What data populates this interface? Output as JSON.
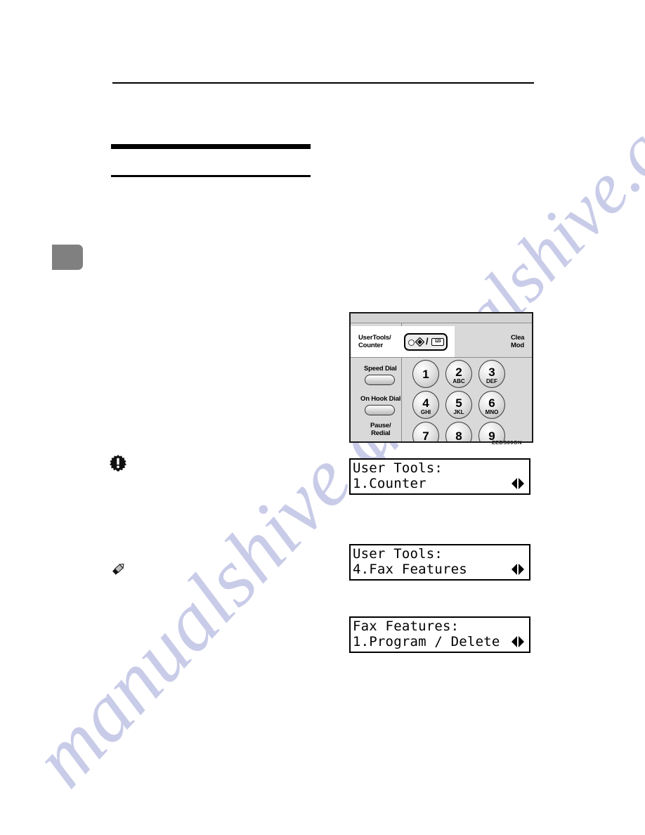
{
  "page": {
    "watermark_text": "manualshive.com",
    "chapter_tab": "",
    "figure_caption": "ZEDS06GN"
  },
  "notices": {
    "important_icon": "important-starburst-icon",
    "note_icon": "note-pencil-icon"
  },
  "control_panel": {
    "user_tools_counter_label": "UserTools/\nCounter",
    "user_tools_label_line1": "UserTools/",
    "user_tools_label_line2": "Counter",
    "clear_modes_label_line1": "Clea",
    "clear_modes_label_line2": "Mod",
    "speed_dial_label": "Speed Dial",
    "on_hook_dial_label": "On Hook Dial",
    "pause_redial_label_line1": "Pause/",
    "pause_redial_label_line2": "Redial",
    "counter_key_glyph": "123",
    "slash_glyph": "/",
    "keypad": [
      {
        "num": "1",
        "letters": ""
      },
      {
        "num": "2",
        "letters": "ABC"
      },
      {
        "num": "3",
        "letters": "DEF"
      },
      {
        "num": "4",
        "letters": "GHI"
      },
      {
        "num": "5",
        "letters": "JKL"
      },
      {
        "num": "6",
        "letters": "MNO"
      },
      {
        "num": "7",
        "letters": ""
      },
      {
        "num": "8",
        "letters": ""
      },
      {
        "num": "9",
        "letters": ""
      }
    ]
  },
  "lcd_screens": [
    {
      "line1": "User Tools:",
      "line2": "1.Counter",
      "arrows": "left-right-arrows"
    },
    {
      "line1": "User Tools:",
      "line2": "4.Fax Features",
      "arrows": "left-right-arrows"
    },
    {
      "line1": "Fax Features:",
      "line2": "1.Program / Delete",
      "arrows": "left-right-arrows"
    }
  ],
  "colors": {
    "panel_background": "#d9d9d9",
    "chapter_tab": "#808080",
    "watermark": "#c9cce8",
    "rule": "#000000"
  }
}
